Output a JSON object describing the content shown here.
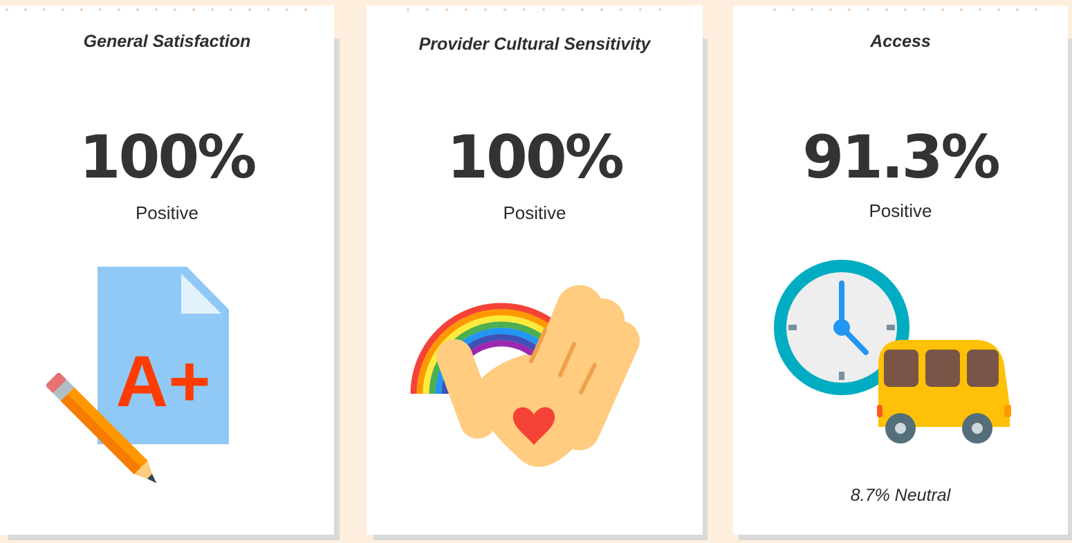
{
  "cards": [
    {
      "title": "General Satisfaction",
      "value": "100%",
      "label": "Positive",
      "icon": "a-plus-grade-paper-icon"
    },
    {
      "title": "Provider Cultural Sensitivity",
      "value": "100%",
      "label": "Positive",
      "icon": "rainbow-hand-heart-icon"
    },
    {
      "title": "Access",
      "value": "91.3%",
      "label": "Positive",
      "icon": "clock-bus-icon",
      "note": "8.7% Neutral"
    }
  ],
  "icon_text": {
    "grade": "A+"
  },
  "colors": {
    "background": "#fdeedd",
    "card": "#ffffff",
    "shadow": "#d9d9d9"
  }
}
